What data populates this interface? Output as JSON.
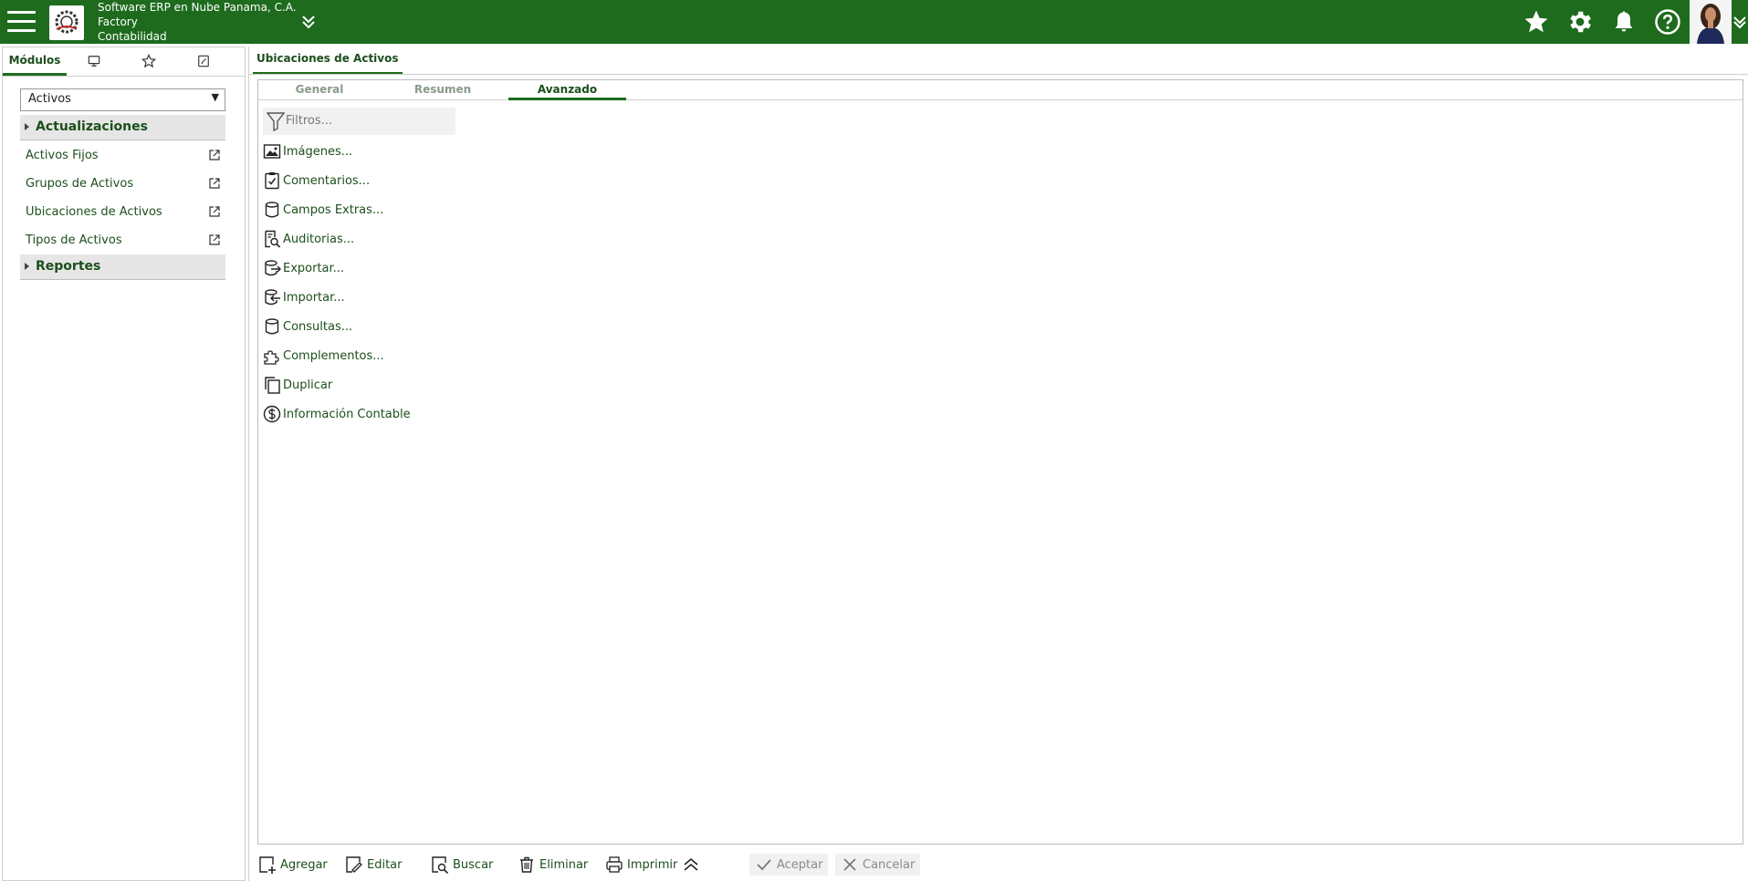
{
  "header": {
    "company": "Software ERP en Nube Panama, C.A.",
    "branch": "Factory",
    "module": "Contabilidad",
    "icons": [
      "menu-icon",
      "logo",
      "chevron-double-down-icon",
      "star-icon",
      "gear-icon",
      "bell-icon",
      "help-icon",
      "avatar",
      "chevron-down-icon"
    ]
  },
  "sidebar": {
    "tabs": [
      {
        "label": "Módulos",
        "icon": ""
      },
      {
        "label": "",
        "icon": "monitor-icon"
      },
      {
        "label": "",
        "icon": "star-outline-icon"
      },
      {
        "label": "",
        "icon": "notepad-icon"
      }
    ],
    "module_select": "Activos",
    "sections": [
      {
        "label": "Actualizaciones",
        "items": [
          "Activos Fijos",
          "Grupos de Activos",
          "Ubicaciones de Activos",
          "Tipos de Activos"
        ]
      },
      {
        "label": "Reportes",
        "items": []
      }
    ]
  },
  "main": {
    "tab": "Ubicaciones de Activos",
    "subtabs": [
      "General",
      "Resumen",
      "Avanzado"
    ],
    "active_subtab": "Avanzado",
    "filter_placeholder": "Filtros...",
    "actions": [
      {
        "label": "Imágenes...",
        "icon": "image-icon"
      },
      {
        "label": "Comentarios...",
        "icon": "clipboard-check-icon"
      },
      {
        "label": "Campos Extras...",
        "icon": "database-icon"
      },
      {
        "label": "Auditorias...",
        "icon": "document-search-icon"
      },
      {
        "label": "Exportar...",
        "icon": "database-export-icon"
      },
      {
        "label": "Importar...",
        "icon": "database-import-icon"
      },
      {
        "label": "Consultas...",
        "icon": "database-icon"
      },
      {
        "label": "Complementos...",
        "icon": "puzzle-icon"
      },
      {
        "label": "Duplicar",
        "icon": "copy-icon"
      },
      {
        "label": "Información Contable",
        "icon": "dollar-circle-icon"
      }
    ]
  },
  "toolbar": {
    "agregar": "Agregar",
    "editar": "Editar",
    "buscar": "Buscar",
    "eliminar": "Eliminar",
    "imprimir": "Imprimir",
    "aceptar": "Aceptar",
    "cancelar": "Cancelar"
  },
  "colors": {
    "brand": "#1e6b1e",
    "text": "#1c4f1c"
  }
}
